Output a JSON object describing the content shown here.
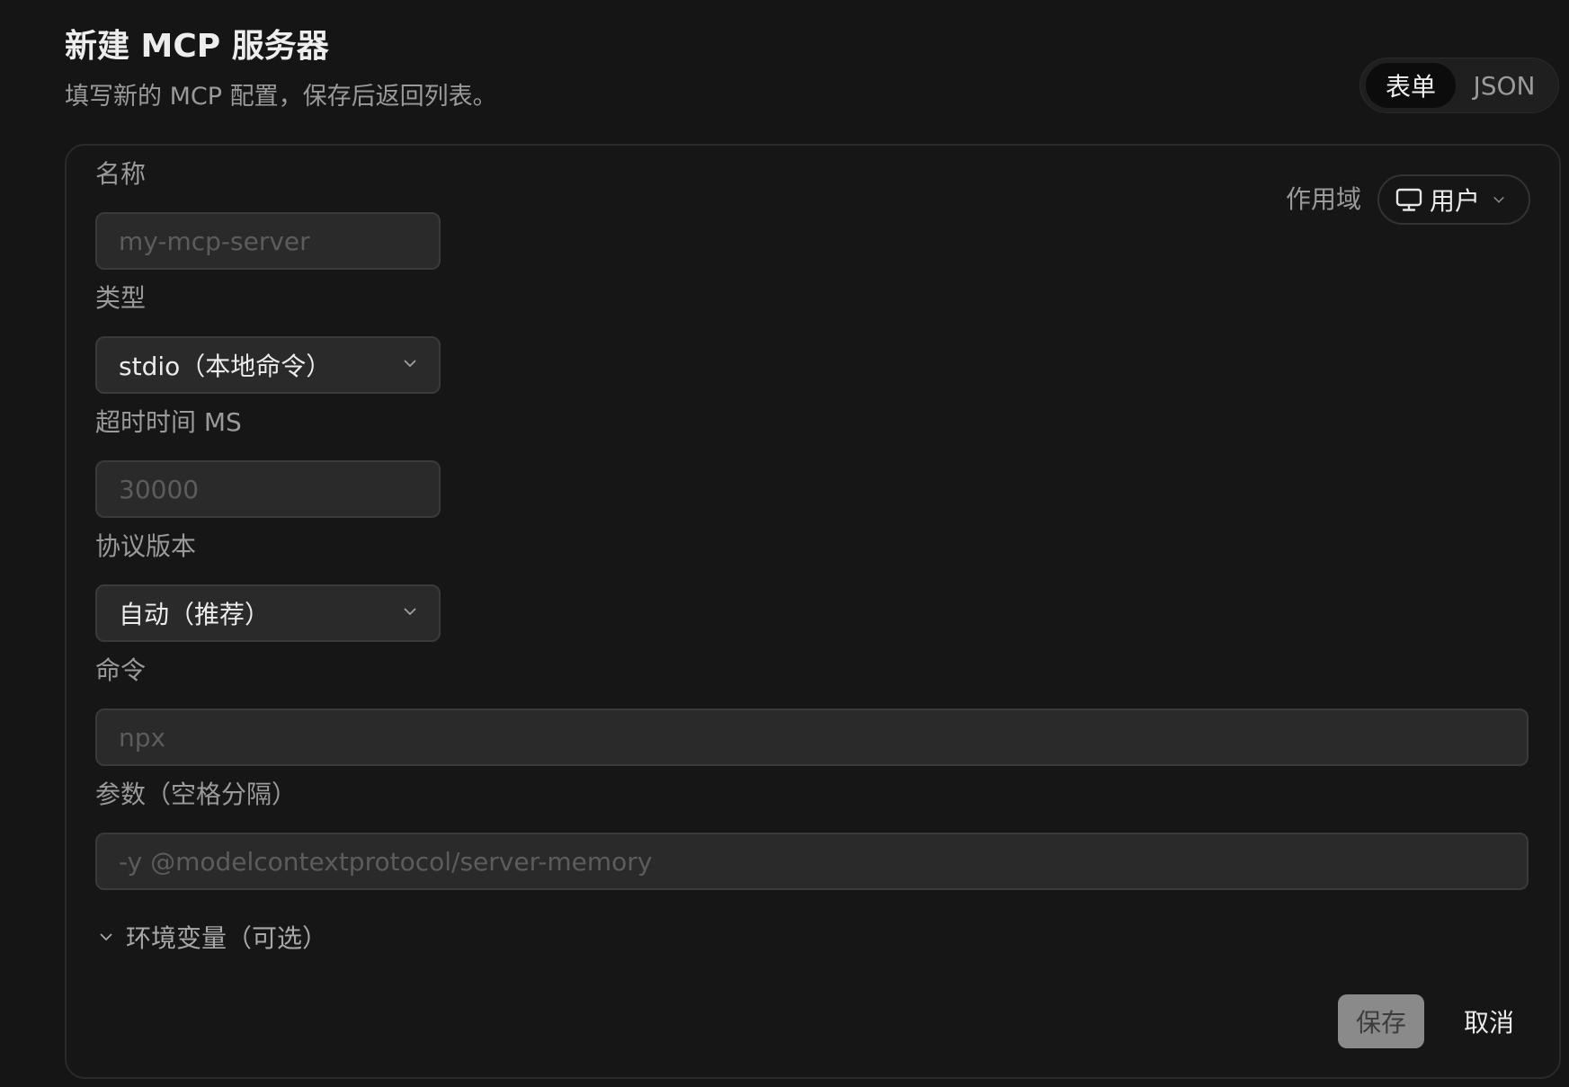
{
  "header": {
    "title": "新建 MCP 服务器",
    "subtitle": "填写新的 MCP 配置，保存后返回列表。"
  },
  "mode_toggle": {
    "form_label": "表单",
    "json_label": "JSON",
    "selected": "表单"
  },
  "form": {
    "name": {
      "label": "名称",
      "value": "",
      "placeholder": "my-mcp-server"
    },
    "type": {
      "label": "类型",
      "selected": "stdio（本地命令）"
    },
    "timeout": {
      "label": "超时时间 MS",
      "value": "",
      "placeholder": "30000"
    },
    "protocol": {
      "label": "协议版本",
      "selected": "自动（推荐）"
    },
    "command": {
      "label": "命令",
      "value": "",
      "placeholder": "npx"
    },
    "args": {
      "label": "参数（空格分隔）",
      "value": "",
      "placeholder": "-y @modelcontextprotocol/server-memory"
    },
    "env": {
      "label": "环境变量（可选）",
      "expanded": false
    },
    "scope": {
      "label": "作用域",
      "selected": "用户",
      "icon": "monitor-icon"
    }
  },
  "actions": {
    "save_label": "保存",
    "cancel_label": "取消"
  },
  "colors": {
    "background": "#151515",
    "card_border": "#2a2a2a",
    "input_bg": "#2a2a2a",
    "save_bg": "#8a8a8a"
  }
}
